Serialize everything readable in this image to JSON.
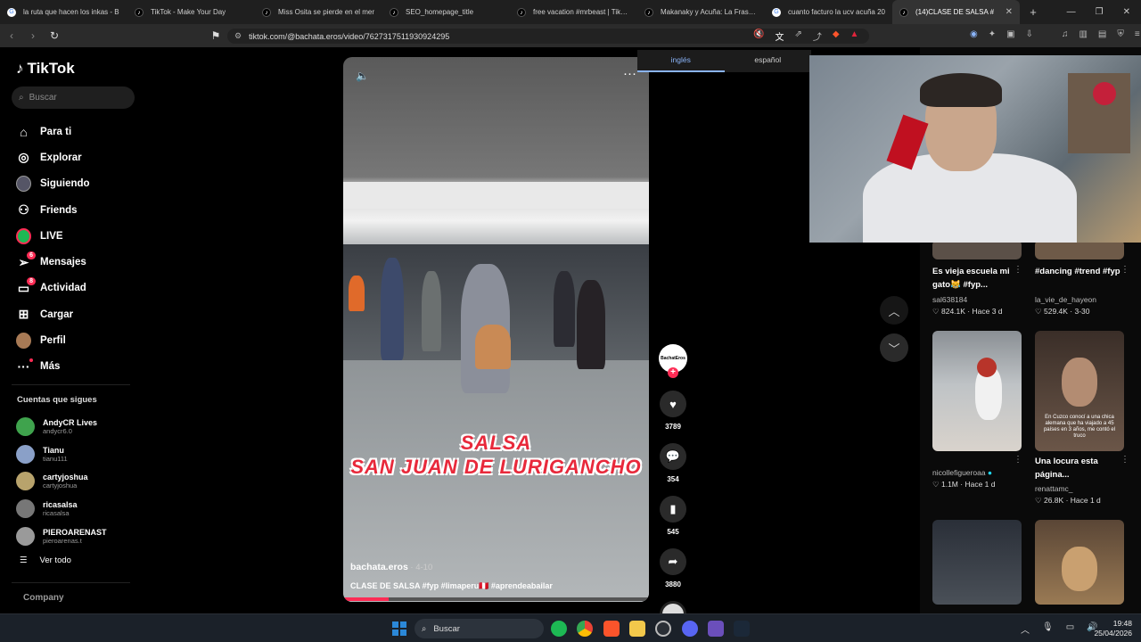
{
  "browser": {
    "tabs": [
      {
        "label": "la ruta que hacen los inkas - B",
        "icon": "google-icon"
      },
      {
        "label": "TikTok - Make Your Day",
        "icon": "tiktok-icon"
      },
      {
        "label": "Miss Osita se pierde en el mer",
        "icon": "tiktok-icon"
      },
      {
        "label": "SEO_homepage_title",
        "icon": "tiktok-icon"
      },
      {
        "label": "free vacation #mrbeast | TikTok",
        "icon": "tiktok-icon"
      },
      {
        "label": "Makanaky y Acuña: La Frase q",
        "icon": "tiktok-icon"
      },
      {
        "label": "cuanto facturo la ucv acuña 20",
        "icon": "google-icon"
      },
      {
        "label": "(14)CLASE DE SALSA #",
        "icon": "tiktok-icon",
        "active": true
      }
    ],
    "url": "tiktok.com/@bachata.eros/video/7627317511930924295"
  },
  "translate": {
    "lang_a": "inglés",
    "lang_b": "español"
  },
  "sidebar": {
    "brand": "TikTok",
    "search_placeholder": "Buscar",
    "nav": [
      {
        "label": "Para ti",
        "icon": "home-icon"
      },
      {
        "label": "Explorar",
        "icon": "compass-icon"
      },
      {
        "label": "Siguiendo",
        "icon": "following-avatar-icon"
      },
      {
        "label": "Friends",
        "icon": "friends-icon"
      },
      {
        "label": "LIVE",
        "icon": "live-icon"
      },
      {
        "label": "Mensajes",
        "icon": "messages-icon",
        "badge": "6"
      },
      {
        "label": "Actividad",
        "icon": "activity-icon",
        "badge": "8"
      },
      {
        "label": "Cargar",
        "icon": "upload-icon"
      },
      {
        "label": "Perfil",
        "icon": "profile-avatar-icon"
      },
      {
        "label": "Más",
        "icon": "more-icon"
      }
    ],
    "following_title": "Cuentas que sigues",
    "accounts": [
      {
        "name": "AndyCR Lives",
        "handle": "andycr6.0"
      },
      {
        "name": "Tianu",
        "handle": "tianu111"
      },
      {
        "name": "cartyjoshua",
        "handle": "cartyjoshua"
      },
      {
        "name": "ricasalsa",
        "handle": "ricasalsa"
      },
      {
        "name": "PIEROARENAST",
        "handle": "pieroarenas.t"
      }
    ],
    "see_all": "Ver todo",
    "company": "Company"
  },
  "video": {
    "overlay_line1": "SALSA",
    "overlay_line2": "SAN JUAN DE LURIGANCHO",
    "author": "bachata.eros",
    "date": " · 4-10",
    "caption": "CLASE DE SALSA #fyp #limaperu🇵🇪 #aprendeabailar",
    "progress": 0.15,
    "avatar_text": "BachatEros"
  },
  "actions": {
    "likes": "3789",
    "comments": "354",
    "saves": "545",
    "shares": "3880"
  },
  "recommended": [
    {
      "title": "Es vieja escuela mi gato😹 #fyp...",
      "author": "sal638184",
      "likes": "824.1K",
      "date": "Hace 3 d"
    },
    {
      "title": "#dancing #trend #fyp",
      "author": "la_vie_de_hayeon",
      "likes": "529.4K",
      "date": "3-30"
    },
    {
      "title": "",
      "author": "nicollefigueroaa",
      "likes": "1.1M",
      "date": "Hace 1 d",
      "verified": true
    },
    {
      "title": "Una locura esta página...",
      "author": "renattamc_",
      "likes": "26.8K",
      "date": "Hace 1 d",
      "thumb_text": "En Cuzco conocí a una chica alemana que ha viajado a 45 países en 3 años, me contó el truco"
    }
  ],
  "taskbar": {
    "search": "Buscar",
    "time": "19:48",
    "date": "25/04/2026"
  }
}
